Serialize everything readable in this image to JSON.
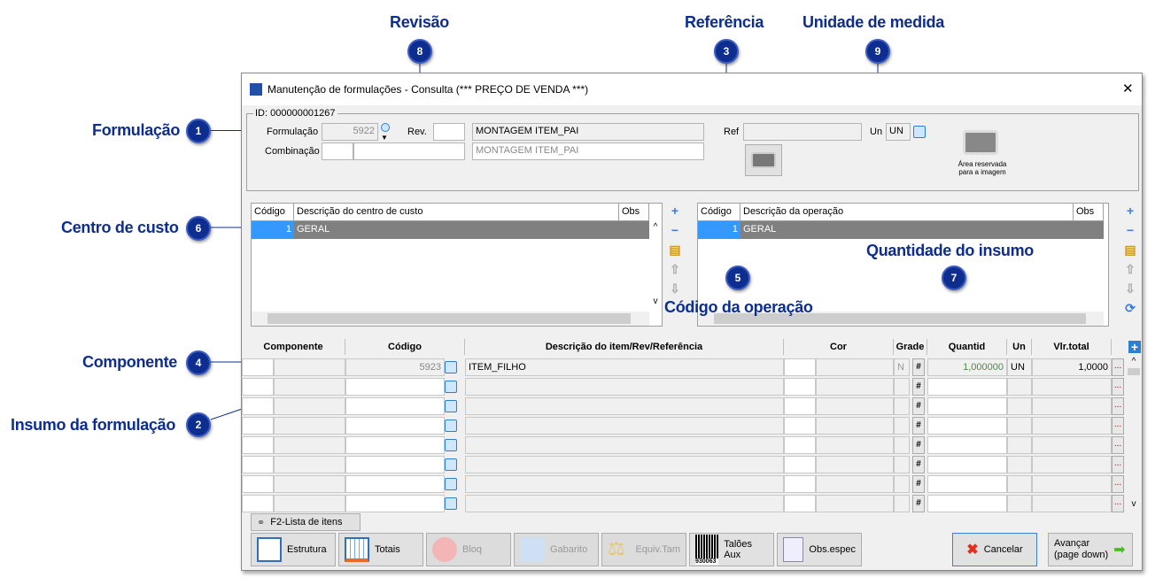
{
  "callouts": [
    {
      "n": "1",
      "label": "Formulação"
    },
    {
      "n": "2",
      "label": "Insumo da formulação"
    },
    {
      "n": "3",
      "label": "Referência"
    },
    {
      "n": "4",
      "label": "Componente"
    },
    {
      "n": "5",
      "label": "Código da operação"
    },
    {
      "n": "6",
      "label": "Centro de custo"
    },
    {
      "n": "7",
      "label": "Quantidade do insumo"
    },
    {
      "n": "8",
      "label": "Revisão"
    },
    {
      "n": "9",
      "label": "Unidade de medida"
    }
  ],
  "window": {
    "title": "Manutenção de formulações - Consulta (*** PREÇO DE VENDA ***)",
    "close": "✕"
  },
  "header": {
    "id_label": "ID: 000000001267",
    "formulacao_label": "Formulação",
    "formulacao_value": "5922",
    "rev_label": "Rev.",
    "rev_value": "",
    "descricao": "MONTAGEM ITEM_PAI",
    "combinacao_label": "Combinação",
    "combinacao_desc": "MONTAGEM ITEM_PAI",
    "ref_label": "Ref",
    "ref_value": "",
    "un_label": "Un",
    "un_value": "UN",
    "image_area": "Área reservada para a imagem"
  },
  "cost_center_grid": {
    "headers": [
      "Código",
      "Descrição do centro de custo",
      "Obs"
    ],
    "rows": [
      {
        "codigo": "1",
        "descricao": "GERAL",
        "obs": ""
      }
    ]
  },
  "operation_grid": {
    "headers": [
      "Código",
      "Descrição da operação",
      "Obs"
    ],
    "rows": [
      {
        "codigo": "1",
        "descricao": "GERAL",
        "obs": ""
      }
    ]
  },
  "items_grid": {
    "headers": [
      "Componente",
      "Código",
      "Descrição do item/Rev/Referência",
      "Cor",
      "Grade",
      "Quantid",
      "Un",
      "Vlr.total"
    ],
    "rows": [
      {
        "codigo": "5923",
        "descricao": "ITEM_FILHO",
        "grade": "N",
        "hash": "#",
        "quantid": "1,000000",
        "un": "UN",
        "vlr_total": "1,0000",
        "more": "..."
      }
    ],
    "empty_hash": "#",
    "empty_more": "..."
  },
  "toolbar": {
    "lista": "F2-Lista de itens",
    "estrutura": "Estrutura",
    "totais": "Totais",
    "bloq": "Bloq",
    "gabarito": "Gabarito",
    "equiv": "Equiv.Tam",
    "taloes": "Talões Aux",
    "barcode": "930063",
    "obs": "Obs.espec",
    "cancelar": "Cancelar",
    "avancar": "Avançar",
    "avancar_sub": "(page down)"
  }
}
